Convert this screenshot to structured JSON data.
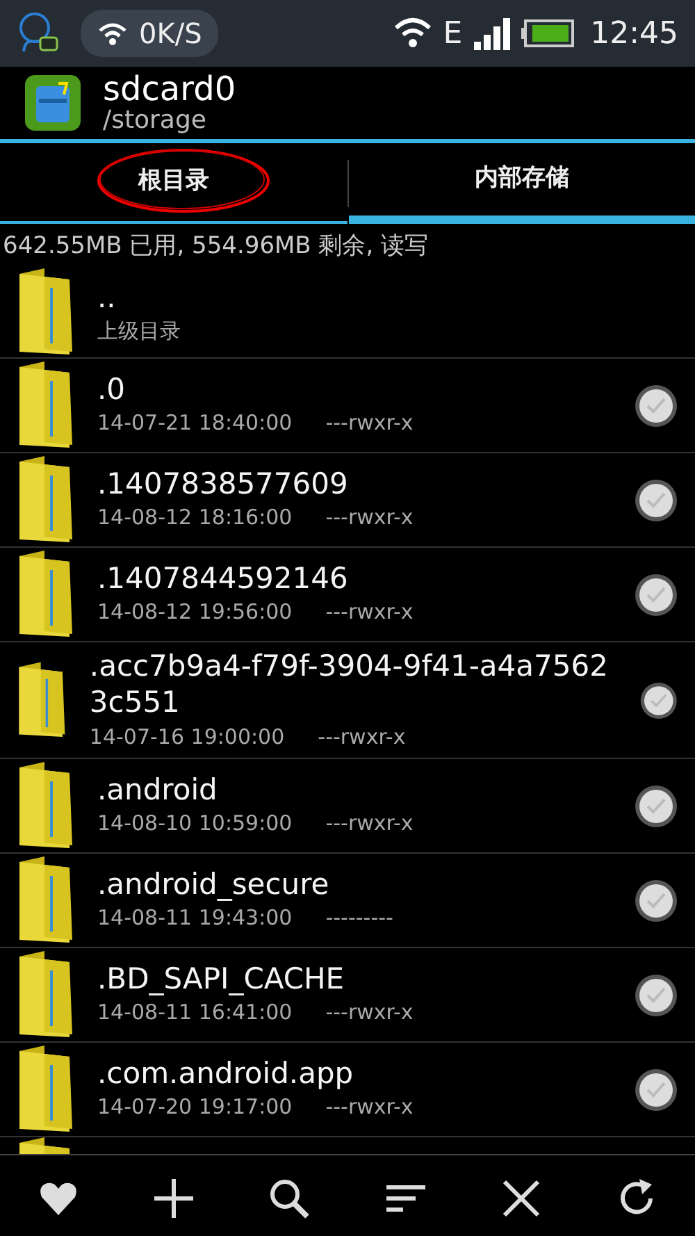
{
  "status_bar": {
    "speed": "0K/S",
    "network": "E",
    "time": "12:45"
  },
  "header": {
    "title": "sdcard0",
    "path": "/storage"
  },
  "tabs": [
    {
      "label": "根目录",
      "selected": false
    },
    {
      "label": "内部存储",
      "selected": true
    }
  ],
  "storage_info": "642.55MB 已用, 554.96MB 剩余, 读写",
  "files": [
    {
      "kind": "parent",
      "name": "..",
      "detail": "上级目录"
    },
    {
      "kind": "folder",
      "name": ".0",
      "date": "14-07-21 18:40:00",
      "perms": "---rwxr-x",
      "checked": false
    },
    {
      "kind": "folder",
      "name": ".1407838577609",
      "date": "14-08-12 18:16:00",
      "perms": "---rwxr-x",
      "checked": false
    },
    {
      "kind": "folder",
      "name": ".1407844592146",
      "date": "14-08-12 19:56:00",
      "perms": "---rwxr-x",
      "checked": false
    },
    {
      "kind": "folder",
      "name": ".acc7b9a4-f79f-3904-9f41-a4a75623c551",
      "date": "14-07-16 19:00:00",
      "perms": "---rwxr-x",
      "checked": false
    },
    {
      "kind": "folder",
      "name": ".android",
      "date": "14-08-10 10:59:00",
      "perms": "---rwxr-x",
      "checked": false
    },
    {
      "kind": "folder",
      "name": ".android_secure",
      "date": "14-08-11 19:43:00",
      "perms": "---------",
      "checked": false
    },
    {
      "kind": "folder",
      "name": ".BD_SAPI_CACHE",
      "date": "14-08-11 16:41:00",
      "perms": "---rwxr-x",
      "checked": false
    },
    {
      "kind": "folder",
      "name": ".com.android.app",
      "date": "14-07-20 19:17:00",
      "perms": "---rwxr-x",
      "checked": false
    },
    {
      "kind": "cut"
    }
  ]
}
